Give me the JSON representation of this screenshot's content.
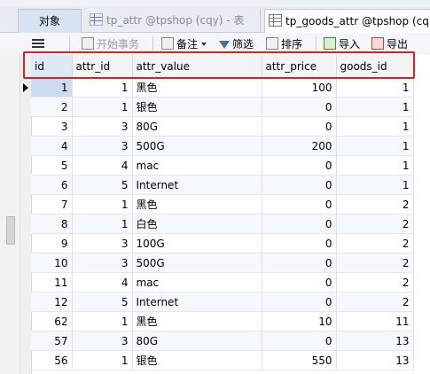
{
  "tabs": [
    {
      "label": "对象"
    },
    {
      "label": "tp_attr @tpshop (cqy) - 表"
    },
    {
      "label": "tp_goods_attr @tpshop (cq..."
    }
  ],
  "toolbar": {
    "begin_transaction": "开始事务",
    "memo": "备注",
    "filter": "筛选",
    "sort": "排序",
    "import": "导入",
    "export": "导出"
  },
  "table": {
    "columns": [
      "id",
      "attr_id",
      "attr_value",
      "attr_price",
      "goods_id"
    ],
    "rows": [
      [
        "1",
        "1",
        "黑色",
        "100",
        "1"
      ],
      [
        "2",
        "1",
        "银色",
        "0",
        "1"
      ],
      [
        "3",
        "3",
        "80G",
        "0",
        "1"
      ],
      [
        "4",
        "3",
        "500G",
        "200",
        "1"
      ],
      [
        "5",
        "4",
        "mac",
        "0",
        "1"
      ],
      [
        "6",
        "5",
        "Internet",
        "0",
        "1"
      ],
      [
        "7",
        "1",
        "黑色",
        "0",
        "2"
      ],
      [
        "8",
        "1",
        "白色",
        "0",
        "2"
      ],
      [
        "9",
        "3",
        "100G",
        "0",
        "2"
      ],
      [
        "10",
        "3",
        "500G",
        "0",
        "2"
      ],
      [
        "11",
        "4",
        "mac",
        "0",
        "2"
      ],
      [
        "12",
        "5",
        "Internet",
        "0",
        "2"
      ],
      [
        "62",
        "1",
        "黑色",
        "10",
        "11"
      ],
      [
        "57",
        "3",
        "80G",
        "0",
        "13"
      ],
      [
        "56",
        "1",
        "银色",
        "550",
        "13"
      ]
    ]
  },
  "colors": {
    "highlight": "#e02020",
    "selected_cell": "#c9dcf2"
  }
}
